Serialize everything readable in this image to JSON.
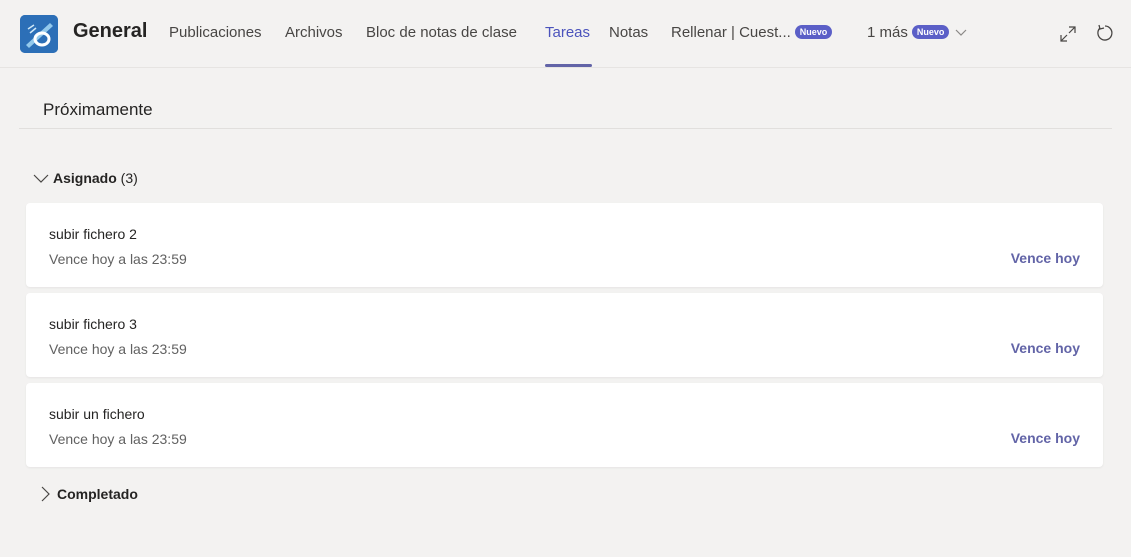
{
  "header": {
    "channel_name": "General",
    "tabs": [
      {
        "label": "Publicaciones"
      },
      {
        "label": "Archivos"
      },
      {
        "label": "Bloc de notas de clase"
      },
      {
        "label": "Tareas",
        "active": true
      },
      {
        "label": "Notas"
      },
      {
        "label": "Rellenar | Cuest...",
        "badge": "Nuevo"
      },
      {
        "label": "1 más",
        "badge": "Nuevo"
      }
    ],
    "accent_color": "#6264a7"
  },
  "main": {
    "section_title": "Próximamente",
    "assigned_group": {
      "label": "Asignado",
      "count": "(3)",
      "items": [
        {
          "title": "subir fichero 2",
          "due": "Vence hoy a las 23:59",
          "status": "Vence hoy"
        },
        {
          "title": "subir fichero 3",
          "due": "Vence hoy a las 23:59",
          "status": "Vence hoy"
        },
        {
          "title": "subir un fichero",
          "due": "Vence hoy a las 23:59",
          "status": "Vence hoy"
        }
      ]
    },
    "completed_group": {
      "label": "Completado"
    }
  }
}
